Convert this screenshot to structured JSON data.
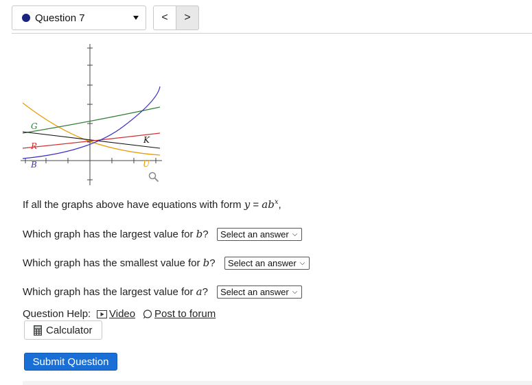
{
  "header": {
    "question_label": "Question 7",
    "prev_label": "<",
    "next_label": ">",
    "dot_color": "#1a237e"
  },
  "graph": {
    "curve_labels": {
      "G": "G",
      "R": "R",
      "K": "K",
      "B": "B",
      "U": "U"
    },
    "colors": {
      "G": "#2e7d32",
      "R": "#d32f2f",
      "K": "#111111",
      "B": "#3b2fc9",
      "U": "#e69b00"
    }
  },
  "question": {
    "intro_prefix": "If all the graphs above have equations with form ",
    "formula_y": "y",
    "formula_eq": " = ",
    "formula_ab": "ab",
    "formula_exp": "x",
    "intro_suffix": ",",
    "q1_prefix": "Which graph has the largest value for ",
    "q1_var": "b",
    "q1_suffix": "?",
    "q2_prefix": "Which graph has the smallest value for ",
    "q2_var": "b",
    "q2_suffix": "?",
    "q3_prefix": "Which graph has the largest value for ",
    "q3_var": "a",
    "q3_suffix": "?",
    "select_placeholder": "Select an answer"
  },
  "help": {
    "label": "Question Help:",
    "video_label": "Video",
    "forum_label": "Post to forum"
  },
  "buttons": {
    "calculator_label": "Calculator",
    "submit_label": "Submit Question",
    "submit_color": "#1a6fd6"
  }
}
